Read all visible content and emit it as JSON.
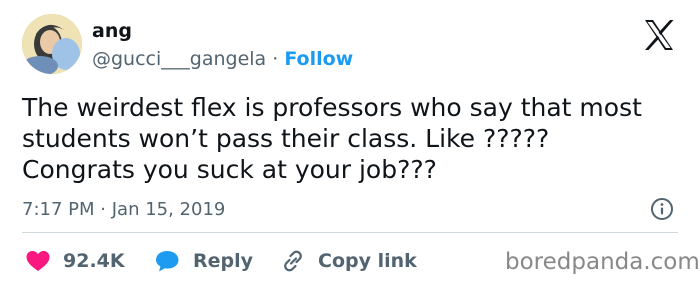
{
  "author": {
    "name": "ang",
    "handle": "@gucci___gangela",
    "separator": "·",
    "follow_label": "Follow"
  },
  "tweet": {
    "lines": [
      "The weirdest flex is professors who say that most",
      "students won’t pass their class. Like ?????",
      "Congrats you suck at your job???"
    ],
    "time": "7:17 PM",
    "date_separator": "·",
    "date": "Jan 15, 2019"
  },
  "actions": {
    "likes": "92.4K",
    "reply_label": "Reply",
    "copy_label": "Copy link"
  },
  "watermark": "boredpanda.com",
  "colors": {
    "accent": "#1d9bf0",
    "like": "#f91880",
    "text": "#0f1419",
    "secondary": "#536471"
  },
  "icons": {
    "logo": "x-logo-icon",
    "info": "info-icon",
    "like": "heart-icon",
    "reply": "speech-bubble-icon",
    "copy": "link-icon"
  }
}
